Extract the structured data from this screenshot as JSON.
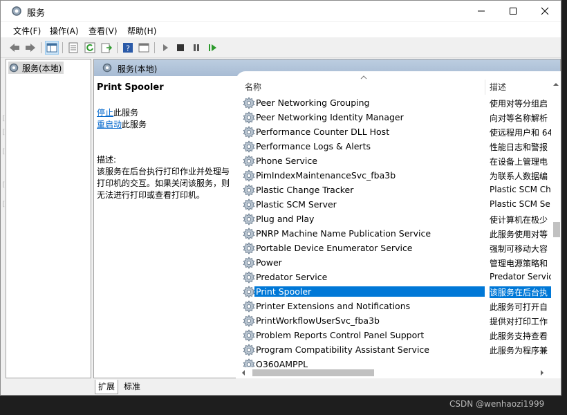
{
  "window": {
    "title": "服务",
    "menu": [
      "文件(F)",
      "操作(A)",
      "查看(V)",
      "帮助(H)"
    ]
  },
  "tree": {
    "root_label": "服务(本地)"
  },
  "pane": {
    "header": "服务(本地)",
    "selected_service": "Print Spooler",
    "stop_link": "停止",
    "stop_suffix": "此服务",
    "restart_link": "重启动",
    "restart_suffix": "此服务",
    "desc_label": "描述:",
    "description": "该服务在后台执行打印作业并处理与打印机的交互。如果关闭该服务，则无法进行打印或查看打印机。"
  },
  "list": {
    "columns": {
      "name": "名称",
      "desc": "描述"
    },
    "rows": [
      {
        "name": "Peer Networking Grouping",
        "desc": "使用对等分组启"
      },
      {
        "name": "Peer Networking Identity Manager",
        "desc": "向对等名称解析"
      },
      {
        "name": "Performance Counter DLL Host",
        "desc": "使远程用户和 64"
      },
      {
        "name": "Performance Logs & Alerts",
        "desc": "性能日志和警报"
      },
      {
        "name": "Phone Service",
        "desc": "在设备上管理电"
      },
      {
        "name": "PimIndexMaintenanceSvc_fba3b",
        "desc": "为联系人数据编"
      },
      {
        "name": "Plastic Change Tracker",
        "desc": "Plastic SCM Ch"
      },
      {
        "name": "Plastic SCM Server",
        "desc": "Plastic SCM Se"
      },
      {
        "name": "Plug and Play",
        "desc": "使计算机在极少"
      },
      {
        "name": "PNRP Machine Name Publication Service",
        "desc": "此服务使用对等"
      },
      {
        "name": "Portable Device Enumerator Service",
        "desc": "强制可移动大容"
      },
      {
        "name": "Power",
        "desc": "管理电源策略和"
      },
      {
        "name": "Predator Service",
        "desc": "Predator Servic"
      },
      {
        "name": "Print Spooler",
        "desc": "该服务在后台执",
        "selected": true
      },
      {
        "name": "Printer Extensions and Notifications",
        "desc": "此服务可打开自"
      },
      {
        "name": "PrintWorkflowUserSvc_fba3b",
        "desc": "提供对打印工作"
      },
      {
        "name": "Problem Reports Control Panel Support",
        "desc": "此服务支持查看"
      },
      {
        "name": "Program Compatibility Assistant Service",
        "desc": "此服务为程序兼"
      },
      {
        "name": "Q360AMPPL",
        "desc": ""
      }
    ]
  },
  "tabs": [
    "扩展",
    "标准"
  ],
  "watermark": "CSDN @wenhaozi1999",
  "colors": {
    "selection": "#0078d7",
    "header_band": "#a8bcd4",
    "link": "#0066cc"
  }
}
